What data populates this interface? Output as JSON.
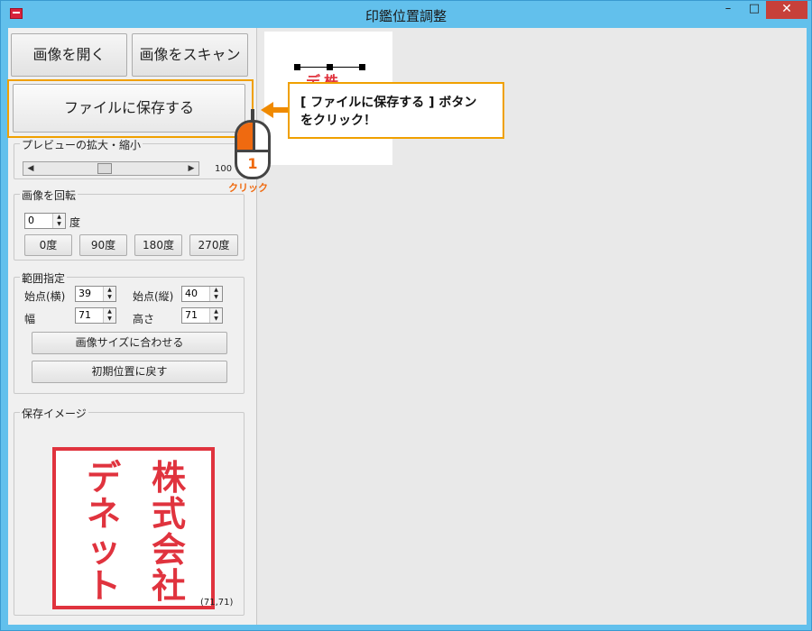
{
  "window": {
    "title": "印鑑位置調整",
    "min": "–",
    "max": "□",
    "close": "✕",
    "accent": "#62c0ec",
    "close_color": "#c7403a"
  },
  "toolbar": {
    "open_image": "画像を開く",
    "scan_image": "画像をスキャン",
    "save_file": "ファイルに保存する"
  },
  "zoom": {
    "title": "プレビューの拡大・縮小",
    "value": "100"
  },
  "rotate": {
    "title": "画像を回転",
    "angle_value": "0",
    "angle_unit": "度",
    "buttons": [
      "0度",
      "90度",
      "180度",
      "270度"
    ]
  },
  "range": {
    "title": "範囲指定",
    "start_x_label": "始点(横)",
    "start_x": "39",
    "start_y_label": "始点(縦)",
    "start_y": "40",
    "width_label": "幅",
    "width": "71",
    "height_label": "高さ",
    "height": "71",
    "fit_button": "画像サイズに合わせる",
    "reset_button": "初期位置に戻す"
  },
  "save_image": {
    "title": "保存イメージ",
    "size": "(71,71)",
    "stamp_left": [
      "デ",
      "ネ",
      "ッ",
      "ト"
    ],
    "stamp_right": [
      "株",
      "式",
      "会",
      "社"
    ],
    "stamp_color": "#e0333e"
  },
  "preview": {
    "peek_text": "デ株"
  },
  "annotation": {
    "callout_line1": "[ ファイルに保存する ] ボタン",
    "callout_line2": "をクリック！",
    "step": "1",
    "click_label": "クリック",
    "accent": "#f0a000"
  }
}
